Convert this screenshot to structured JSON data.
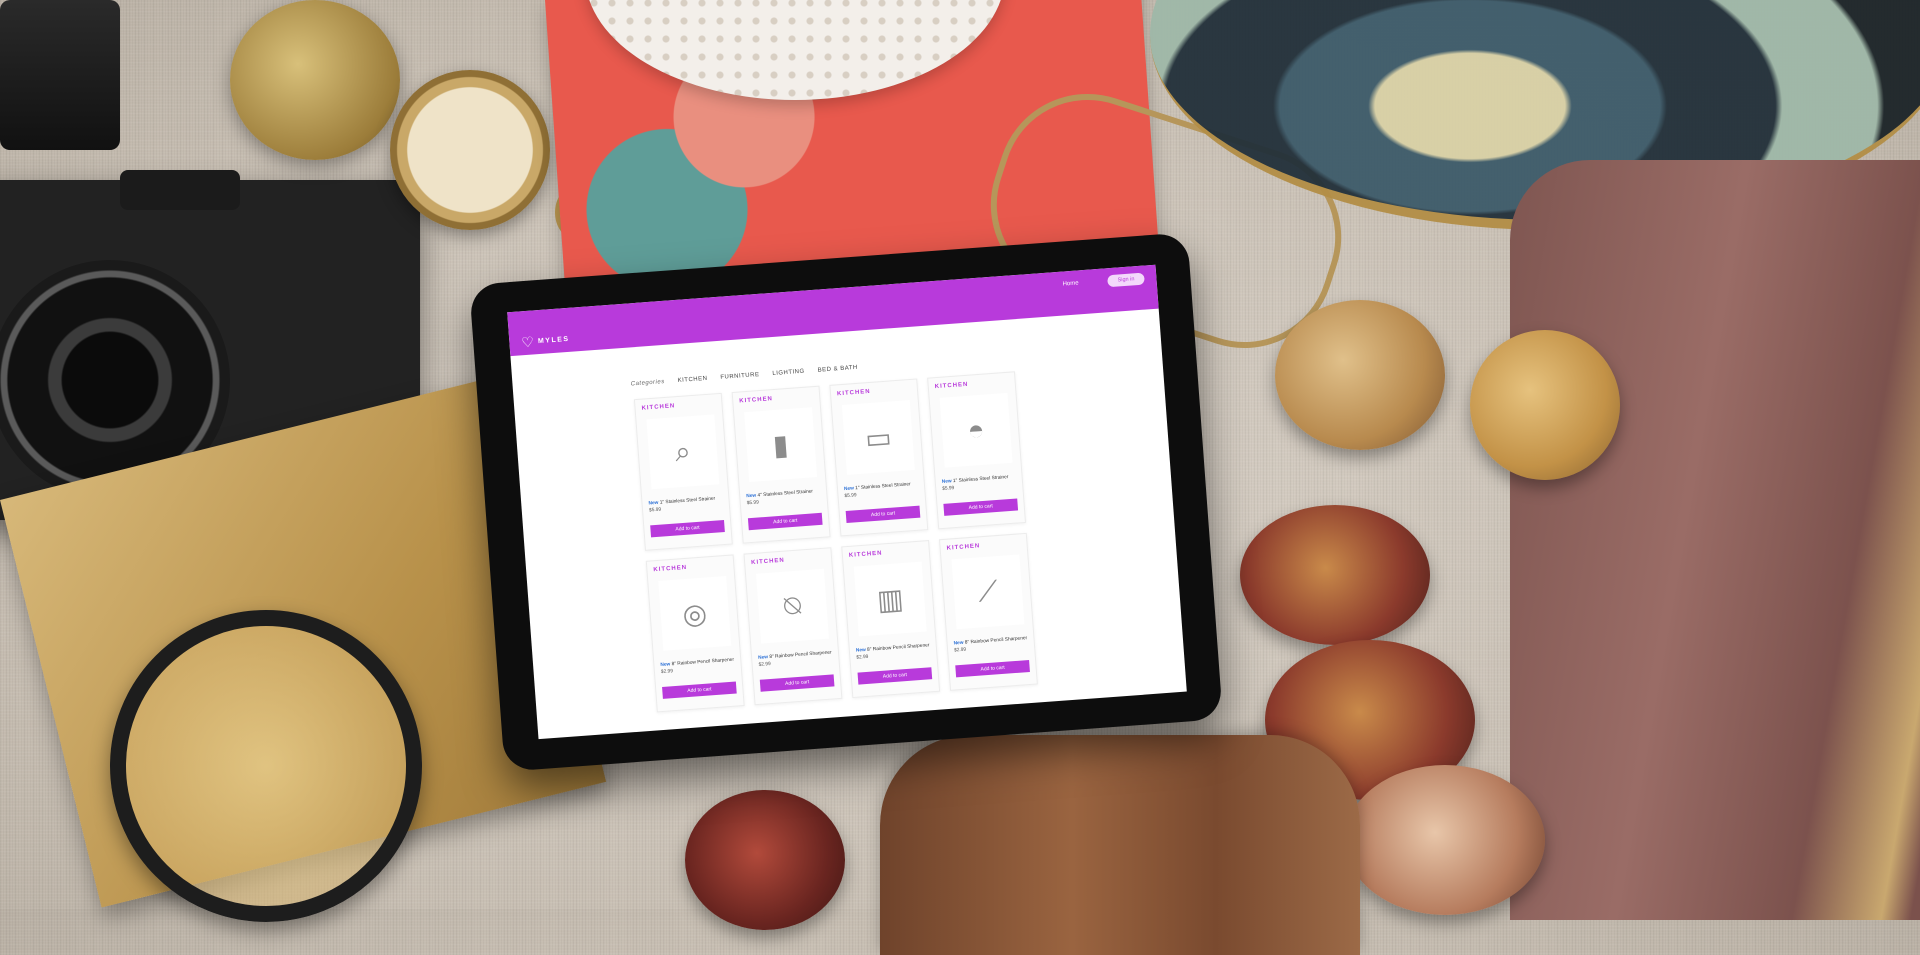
{
  "site": {
    "brand": "MYLES"
  },
  "nav": {
    "home": "Home",
    "signin": "Sign in"
  },
  "categories_bar": {
    "label": "Categories",
    "items": [
      "KITCHEN",
      "FURNITURE",
      "LIGHTING",
      "BED & BATH"
    ]
  },
  "products": [
    {
      "category": "KITCHEN",
      "new": "New",
      "title": "1\" Stainless Steel Strainer",
      "price": "$5.99",
      "cta": "Add to cart",
      "icon": "strainer-icon"
    },
    {
      "category": "KITCHEN",
      "new": "New",
      "title": "4\" Stainless Steel Strainer",
      "price": "$5.99",
      "cta": "Add to cart",
      "icon": "sifter-icon"
    },
    {
      "category": "KITCHEN",
      "new": "New",
      "title": "1\" Stainless Steel Strainer",
      "price": "$5.99",
      "cta": "Add to cart",
      "icon": "baking-mat-icon"
    },
    {
      "category": "KITCHEN",
      "new": "New",
      "title": "1\" Stainless Steel Strainer",
      "price": "$5.99",
      "cta": "Add to cart",
      "icon": "saucepan-icon"
    },
    {
      "category": "KITCHEN",
      "new": "New",
      "title": "8\" Rainbow Pencil Sharpener",
      "price": "$2.99",
      "cta": "Add to cart",
      "icon": "measuring-cups-icon"
    },
    {
      "category": "KITCHEN",
      "new": "New",
      "title": "8\" Rainbow Pencil Sharpener",
      "price": "$2.99",
      "cta": "Add to cart",
      "icon": "whisk-icon"
    },
    {
      "category": "KITCHEN",
      "new": "New",
      "title": "8\" Rainbow Pencil Sharpener",
      "price": "$2.99",
      "cta": "Add to cart",
      "icon": "measuring-jug-icon"
    },
    {
      "category": "KITCHEN",
      "new": "New",
      "title": "8\" Rainbow Pencil Sharpener",
      "price": "$2.99",
      "cta": "Add to cart",
      "icon": "rolling-pin-icon"
    }
  ],
  "colors": {
    "accent": "#b83adb",
    "new_badge": "#2a6fd6",
    "signin_bg": "#f3d8fb"
  }
}
